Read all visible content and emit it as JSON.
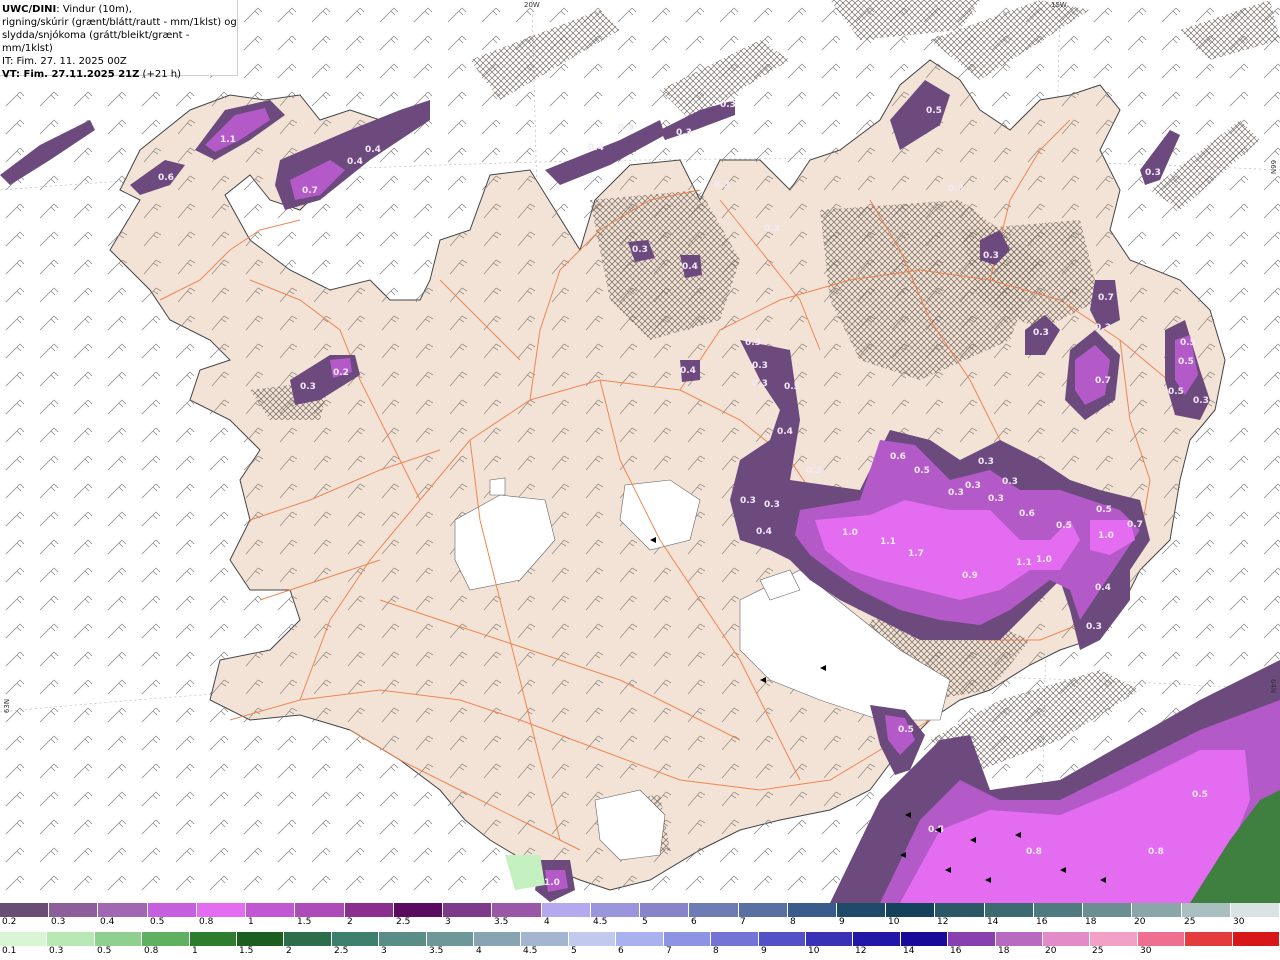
{
  "header": {
    "model": "UWC/DINI",
    "desc_line1": ": Vindur (10m),",
    "desc_line2": "rigning/skúrir (grænt/blátt/rautt - mm/1klst) og",
    "desc_line3": "slydda/snjókoma (grátt/bleikt/grænt - mm/1klst)",
    "it_line": "IT: Fim. 27. 11. 2025 00Z",
    "vt_label": "VT: Fim. 27.11.2025 21Z",
    "vt_offset": " (+21 h)"
  },
  "grid_labels": {
    "lon_20w": "20W",
    "lon_15w": "15W",
    "lat_right_66": "66N",
    "lat_left_63": "63N",
    "lat_right_64": "64N"
  },
  "colors": {
    "sea": "#ffffff",
    "land": "#f2e3d6",
    "coast": "#444444",
    "roads": "#ee7d47",
    "glacier": "#ffffff",
    "precip_dark": "#6d4a7e",
    "precip_mid": "#b35ac8",
    "precip_light": "#e36cf0",
    "precip_rain_green": "#c5f0c0",
    "precip_green_dark": "#3f7f3f"
  },
  "precip_labels": [
    "0.3",
    "0.4",
    "0.5",
    "0.6",
    "0.7",
    "0.8",
    "0.9",
    "1.0",
    "1.1",
    "1.7",
    "0.2"
  ],
  "legend": {
    "snow": {
      "labels": [
        "0.2",
        "0.3",
        "0.4",
        "0.5",
        "0.8",
        "1",
        "1.5",
        "2",
        "2.5",
        "3",
        "3.5",
        "4",
        "4.5",
        "5",
        "6",
        "7",
        "8",
        "9",
        "10",
        "12",
        "14",
        "16",
        "18",
        "20",
        "25",
        "30"
      ],
      "colors": [
        "#6a4d74",
        "#8c5f9a",
        "#a167b3",
        "#c55fe0",
        "#e46cf2",
        "#c257d4",
        "#ad4bb8",
        "#8a2e8f",
        "#5a0a5f",
        "#7e3a8a",
        "#9a56a7",
        "#b4a8ee",
        "#9a95dc",
        "#8884cb",
        "#6e7cb6",
        "#5a6fa2",
        "#395c8c",
        "#1f4b6b",
        "#14425a",
        "#2a5866",
        "#3c6a72",
        "#4e7a80",
        "#6a8e92",
        "#8aa6a8",
        "#aac0c0",
        "#d9e3e3"
      ]
    },
    "rain": {
      "labels": [
        "0.1",
        "0.3",
        "0.5",
        "0.8",
        "1",
        "1.5",
        "2",
        "2.5",
        "3",
        "3.5",
        "4",
        "4.5",
        "5",
        "6",
        "7",
        "8",
        "9",
        "10",
        "12",
        "14",
        "16",
        "18",
        "20",
        "25",
        "30"
      ],
      "colors": [
        "#d8f6d4",
        "#b8e8b4",
        "#8fd090",
        "#5fb060",
        "#2e7d2f",
        "#1c5e20",
        "#2d6d4a",
        "#3f7f6e",
        "#5a8d86",
        "#6e979a",
        "#88a3b2",
        "#a3b5d0",
        "#c1c9ee",
        "#a9b1ee",
        "#8e94e4",
        "#7473d6",
        "#5450c6",
        "#3a31b6",
        "#2317a8",
        "#1a0a99",
        "#8a3fb0",
        "#b86ac0",
        "#e28bc8",
        "#f2a0c6",
        "#ee6f8f",
        "#e43c3c",
        "#d81818"
      ]
    }
  }
}
